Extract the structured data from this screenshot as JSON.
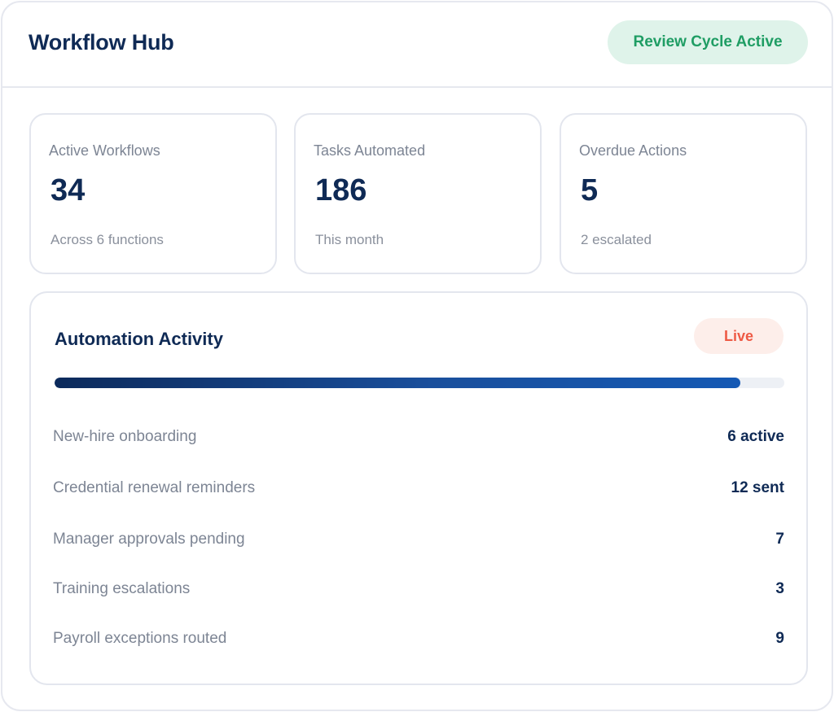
{
  "header": {
    "title": "Workflow Hub",
    "status_badge": "Review Cycle Active"
  },
  "stats": [
    {
      "label": "Active Workflows",
      "value": "34",
      "sub": "Across 6 functions"
    },
    {
      "label": "Tasks Automated",
      "value": "186",
      "sub": "This month"
    },
    {
      "label": "Overdue Actions",
      "value": "5",
      "sub": "2 escalated"
    }
  ],
  "activity": {
    "title": "Automation Activity",
    "badge": "Live",
    "progress_fraction": 0.94,
    "rows": [
      {
        "label": "New-hire onboarding",
        "value": "6 active"
      },
      {
        "label": "Credential renewal reminders",
        "value": "12 sent"
      },
      {
        "label": "Manager approvals pending",
        "value": "7"
      },
      {
        "label": "Training escalations",
        "value": "3"
      },
      {
        "label": "Payroll exceptions routed",
        "value": "9"
      }
    ]
  },
  "colors": {
    "brand_navy": "#0f2a55",
    "status_green": "#1f9d64",
    "status_green_bg": "#dff3ea",
    "live_red": "#ee5a45",
    "live_red_bg": "#fdeeea"
  }
}
